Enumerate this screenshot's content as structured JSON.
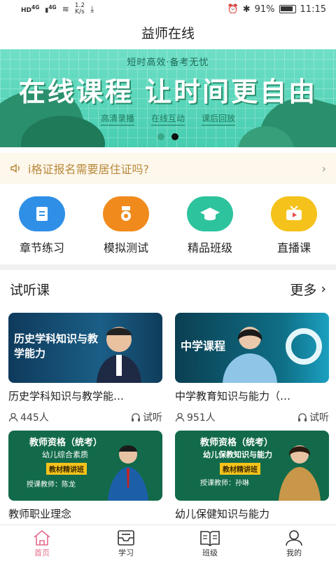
{
  "status_bar": {
    "network_left": "4G",
    "network_right": "4G",
    "speed_value": "1.2",
    "speed_unit": "K/s",
    "battery": "91%",
    "time": "11:15"
  },
  "app_title": "益师在线",
  "banner": {
    "subtitle": "短时高效·备考无忧",
    "headline": "在线课程 让时间更自由",
    "tags": [
      "高清录播",
      "在线互动",
      "课后回放"
    ],
    "slide_count": 2,
    "active_slide": 2
  },
  "notice": {
    "text": "i格证报名需要居住证吗?"
  },
  "features": [
    {
      "label": "章节练习",
      "icon": "clipboard-icon",
      "color": "#2f8fe6"
    },
    {
      "label": "模拟测试",
      "icon": "medal-icon",
      "color": "#f08a1c"
    },
    {
      "label": "精品班级",
      "icon": "graduation-cap-icon",
      "color": "#2cc39d"
    },
    {
      "label": "直播课",
      "icon": "tv-icon",
      "color": "#f5c21b"
    }
  ],
  "trial_section": {
    "title": "试听课",
    "more_label": "更多"
  },
  "courses": [
    {
      "title": "历史学科知识与教学能…",
      "thumb_caption": "历史学科知识与教学能力",
      "enrolled": "445人",
      "trial_label": "试听"
    },
    {
      "title": "中学教育知识与能力（…",
      "thumb_caption": "中学课程",
      "enrolled": "951人",
      "trial_label": "试听"
    },
    {
      "title": "教师职业理念",
      "thumb_caption": "教师资格（统考）",
      "thumb_sub": "幼儿综合素质",
      "thumb_badge": "教材精讲班",
      "thumb_teacher": "授课教师：陈龙"
    },
    {
      "title": "幼儿保健知识与能力",
      "thumb_caption": "教师资格（统考）",
      "thumb_sub": "幼儿保教知识与能力",
      "thumb_badge": "教材精讲班",
      "thumb_teacher": "授课教师：孙琳"
    }
  ],
  "tabbar": [
    {
      "label": "首页",
      "icon": "home-icon",
      "active": true
    },
    {
      "label": "学习",
      "icon": "inbox-icon",
      "active": false
    },
    {
      "label": "班级",
      "icon": "book-icon",
      "active": false
    },
    {
      "label": "我的",
      "icon": "person-icon",
      "active": false
    }
  ],
  "colors": {
    "accent": "#e36b8a",
    "banner_green": "#46cdb0",
    "notice_text": "#b8893a"
  }
}
